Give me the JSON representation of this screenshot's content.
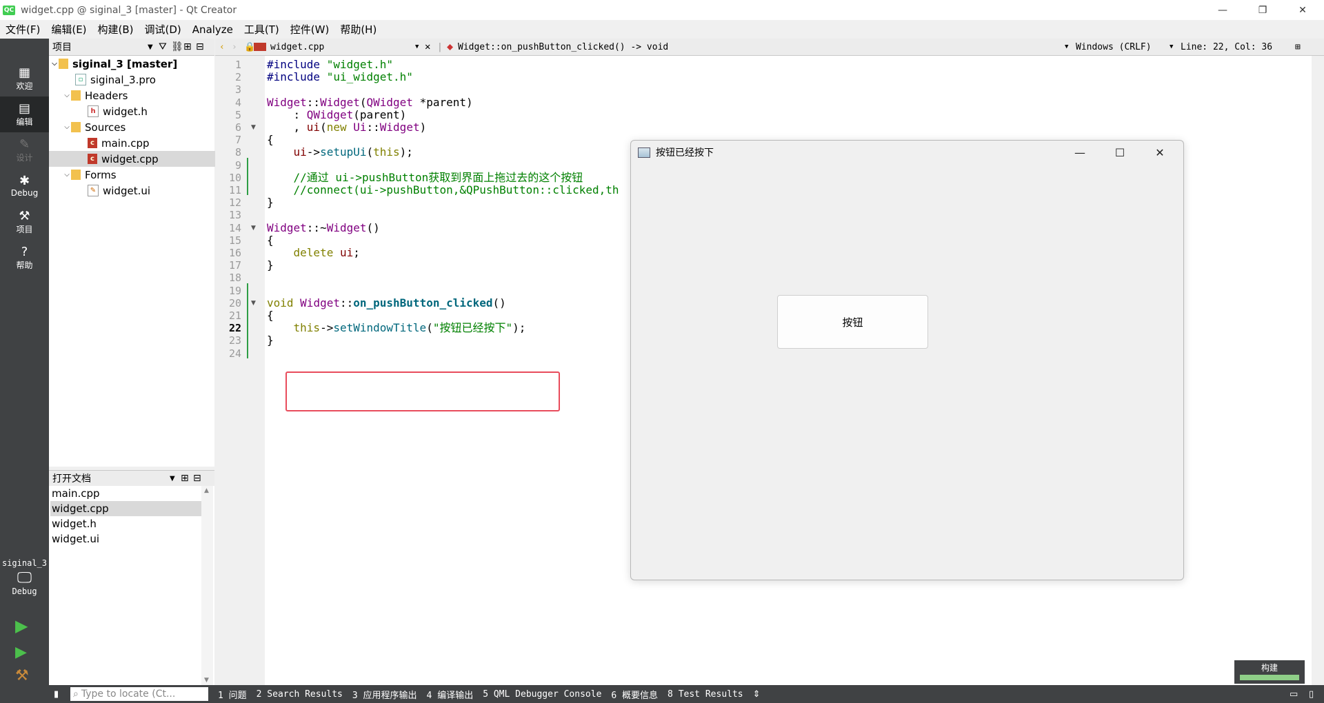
{
  "window": {
    "title": "widget.cpp @ siginal_3 [master] - Qt Creator",
    "app_icon_text": "QC"
  },
  "menus": [
    "文件(F)",
    "编辑(E)",
    "构建(B)",
    "调试(D)",
    "Analyze",
    "工具(T)",
    "控件(W)",
    "帮助(H)"
  ],
  "modes": [
    {
      "label": "欢迎",
      "icon": "grid-icon"
    },
    {
      "label": "编辑",
      "icon": "edit-icon"
    },
    {
      "label": "设计",
      "icon": "pencil-icon"
    },
    {
      "label": "Debug",
      "icon": "bug-icon"
    },
    {
      "label": "项目",
      "icon": "wrench-icon"
    },
    {
      "label": "帮助",
      "icon": "help-icon"
    }
  ],
  "kit": {
    "name": "siginal_3",
    "build": "Debug"
  },
  "project_panel": {
    "title": "项目",
    "tree": [
      {
        "label": "siginal_3 [master]",
        "depth": 0,
        "expanded": true,
        "kind": "project"
      },
      {
        "label": "siginal_3.pro",
        "depth": 1,
        "kind": "pro"
      },
      {
        "label": "Headers",
        "depth": 1,
        "expanded": true,
        "kind": "folder"
      },
      {
        "label": "widget.h",
        "depth": 2,
        "kind": "header"
      },
      {
        "label": "Sources",
        "depth": 1,
        "expanded": true,
        "kind": "folder"
      },
      {
        "label": "main.cpp",
        "depth": 2,
        "kind": "cpp"
      },
      {
        "label": "widget.cpp",
        "depth": 2,
        "kind": "cpp",
        "selected": true
      },
      {
        "label": "Forms",
        "depth": 1,
        "expanded": true,
        "kind": "folder"
      },
      {
        "label": "widget.ui",
        "depth": 2,
        "kind": "ui"
      }
    ]
  },
  "open_docs": {
    "title": "打开文档",
    "items": [
      {
        "label": "main.cpp"
      },
      {
        "label": "widget.cpp",
        "selected": true
      },
      {
        "label": "widget.h"
      },
      {
        "label": "widget.ui"
      }
    ]
  },
  "editor_toolbar": {
    "file": "widget.cpp",
    "symbol": "Widget::on_pushButton_clicked() -> void",
    "encoding": "Windows (CRLF)",
    "position": "Line: 22, Col: 36"
  },
  "editor": {
    "current_line": 22,
    "line_count": 24,
    "code": [
      "#include \"widget.h\"",
      "#include \"ui_widget.h\"",
      "",
      "Widget::Widget(QWidget *parent)",
      "    : QWidget(parent)",
      "    , ui(new Ui::Widget)",
      "{",
      "    ui->setupUi(this);",
      "",
      "    //通过 ui->pushButton获取到界面上拖过去的这个按钮",
      "    //connect(ui->pushButton,&QPushButton::clicked,th",
      "}",
      "",
      "Widget::~Widget()",
      "{",
      "    delete ui;",
      "}",
      "",
      "",
      "void Widget::on_pushButton_clicked()",
      "{",
      "    this->setWindowTitle(\"按钮已经按下\");",
      "}",
      ""
    ]
  },
  "app_window": {
    "title": "按钮已经按下",
    "button_label": "按钮"
  },
  "build_badge": {
    "label": "构建"
  },
  "statusbar": {
    "locator_placeholder": "Type to locate (Ct...",
    "panes": [
      "1 问题",
      "2 Search Results",
      "3 应用程序输出",
      "4 编译输出",
      "5 QML Debugger Console",
      "6 概要信息",
      "8 Test Results"
    ]
  },
  "colors": {
    "highlight_box": "#e84b5b",
    "mode_bar": "#404244",
    "change_bar": "#2e9e45"
  }
}
